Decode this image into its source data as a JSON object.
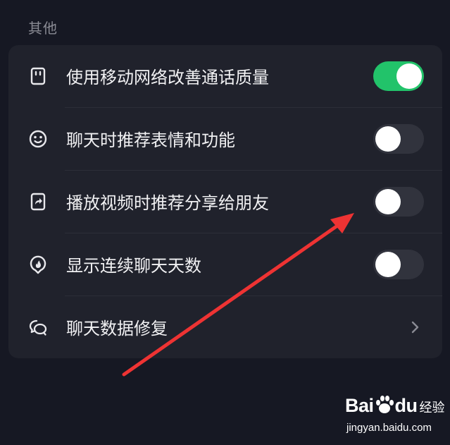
{
  "section": {
    "title": "其他"
  },
  "settings": [
    {
      "icon": "sim-card-icon",
      "label": "使用移动网络改善通话质量",
      "control": "toggle",
      "state": "on"
    },
    {
      "icon": "smiley-icon",
      "label": "聊天时推荐表情和功能",
      "control": "toggle",
      "state": "off"
    },
    {
      "icon": "share-icon",
      "label": "播放视频时推荐分享给朋友",
      "control": "toggle",
      "state": "off"
    },
    {
      "icon": "flame-icon",
      "label": "显示连续聊天天数",
      "control": "toggle",
      "state": "off"
    },
    {
      "icon": "chat-repair-icon",
      "label": "聊天数据修复",
      "control": "chevron"
    }
  ],
  "colors": {
    "background": "#161823",
    "card": "#20222c",
    "toggle_on": "#22c36a",
    "toggle_off": "#31333d",
    "annotation_arrow": "#ee3333"
  },
  "watermark": {
    "logo_left": "Bai",
    "logo_right": "du",
    "cn": "经验",
    "url": "jingyan.baidu.com"
  }
}
